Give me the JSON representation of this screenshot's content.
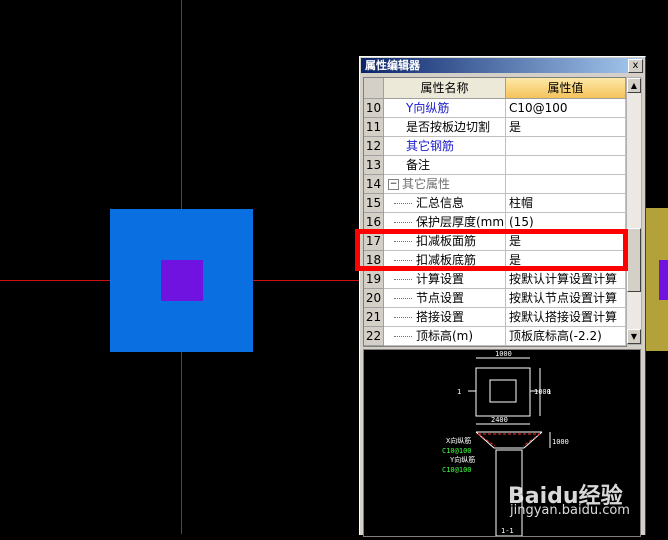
{
  "panel": {
    "title": "属性编辑器",
    "close": "x",
    "headers": {
      "num": "",
      "name": "属性名称",
      "value": "属性值"
    },
    "rows": [
      {
        "num": "10",
        "name": "Y向纵筋",
        "value": "C10@100",
        "style": "blue"
      },
      {
        "num": "11",
        "name": "是否按板边切割",
        "value": "是",
        "style": "normal"
      },
      {
        "num": "12",
        "name": "其它钢筋",
        "value": "",
        "style": "blue"
      },
      {
        "num": "13",
        "name": "备注",
        "value": "",
        "style": "normal"
      },
      {
        "num": "14",
        "name": "其它属性",
        "value": "",
        "style": "group"
      },
      {
        "num": "15",
        "name": "汇总信息",
        "value": "柱帽",
        "style": "tree"
      },
      {
        "num": "16",
        "name": "保护层厚度(mm)",
        "value": "(15)",
        "style": "tree"
      },
      {
        "num": "17",
        "name": "扣减板面筋",
        "value": "是",
        "style": "tree"
      },
      {
        "num": "18",
        "name": "扣减板底筋",
        "value": "是",
        "style": "tree"
      },
      {
        "num": "19",
        "name": "计算设置",
        "value": "按默认计算设置计算",
        "style": "tree"
      },
      {
        "num": "20",
        "name": "节点设置",
        "value": "按默认节点设置计算",
        "style": "tree"
      },
      {
        "num": "21",
        "name": "搭接设置",
        "value": "按默认搭接设置计算",
        "style": "tree"
      },
      {
        "num": "22",
        "name": "顶标高(m)",
        "value": "顶板底标高(-2.2)",
        "style": "tree"
      }
    ],
    "group_toggle": "−"
  },
  "preview": {
    "dim_top": "1000",
    "dim_bottom": "2400",
    "dim_side": "1000",
    "label_1": "1",
    "label_2": "1",
    "label_x": "X向纵筋",
    "label_x_val": "C10@100",
    "label_y": "Y向纵筋",
    "label_y_val": "C10@100",
    "label_11": "1-1",
    "label_h": "1000"
  },
  "watermark": {
    "brand": "Baidu经验",
    "url": "jingyan.baidu.com"
  },
  "colors": {
    "crosshair": "#d01010",
    "column": "#0a6fe0",
    "cap": "#7012e0",
    "highlight": "#ff0000"
  }
}
